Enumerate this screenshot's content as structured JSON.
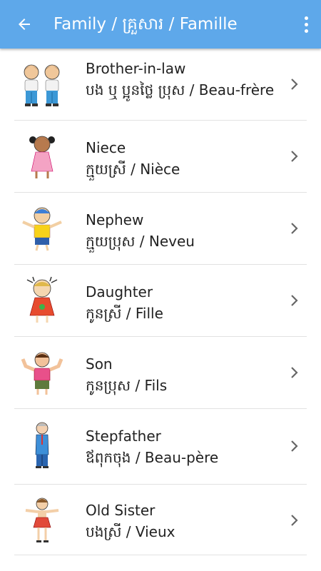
{
  "appbar": {
    "title": "Family / គ្រួសារ / Famille",
    "back_icon": "arrow-left-icon",
    "menu_icon": "more-vert-icon",
    "color": "#5ea8ea"
  },
  "items": [
    {
      "english": "Brother-in-law",
      "translation": "បង ឬ ប្អូនថ្លៃ ប្រុស  /  Beau-frère",
      "icon": "brothers-icon"
    },
    {
      "english": "Niece",
      "translation": "ក្មួយស្រី  /  Nièce",
      "icon": "girl-icon"
    },
    {
      "english": "Nephew",
      "translation": "ក្មួយប្រុស  /  Neveu",
      "icon": "boy-icon"
    },
    {
      "english": "Daughter",
      "translation": "កូនស្រី  /  Fille",
      "icon": "daughter-icon"
    },
    {
      "english": "Son",
      "translation": "កូនប្រុស  /  Fils",
      "icon": "son-icon"
    },
    {
      "english": "Stepfather",
      "translation": "ឪពុកចុង  /  Beau-père",
      "icon": "stepfather-icon"
    },
    {
      "english": "Old Sister",
      "translation": "បងស្រី  /  Vieux",
      "icon": "old-sister-icon"
    }
  ]
}
